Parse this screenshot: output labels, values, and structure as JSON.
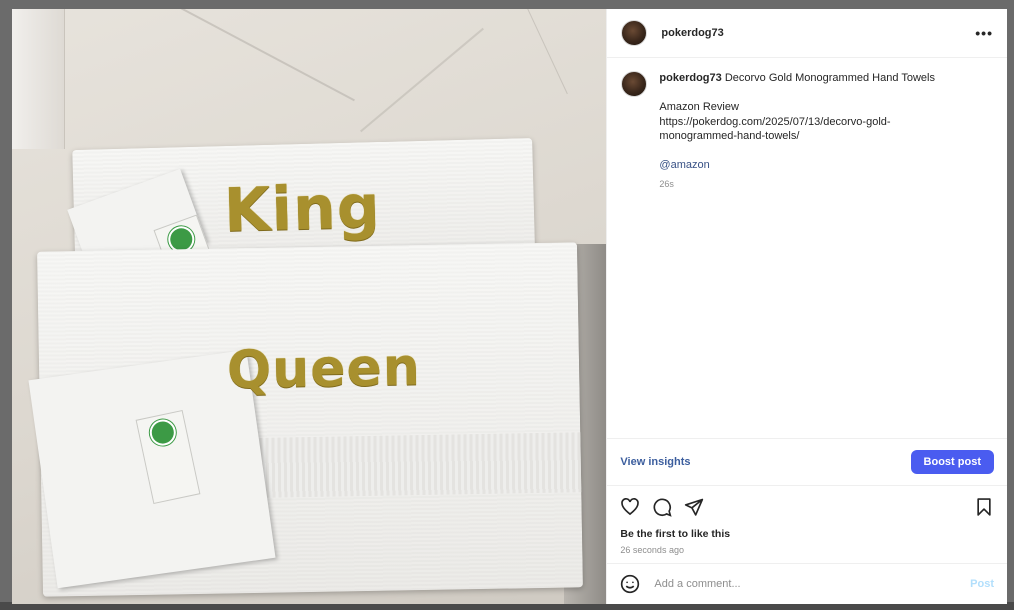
{
  "post": {
    "username": "pokerdog73",
    "photo": {
      "monogram_top": "King",
      "monogram_bottom": "Queen",
      "thread_color": "#a8902e"
    },
    "caption": {
      "username": "pokerdog73",
      "title": "Decorvo Gold Monogrammed Hand Towels",
      "review_label": "Amazon Review",
      "url_line1": "https://pokerdog.com/2025/07/13/decorvo-gold-",
      "url_line2": "monogrammed-hand-towels/",
      "mention": "@amazon",
      "time": "26s"
    },
    "insights_label": "View insights",
    "boost_label": "Boost post",
    "likes_text": "Be the first to like this",
    "time_ago": "26 seconds ago",
    "comment": {
      "placeholder": "Add a comment...",
      "post_label": "Post"
    },
    "icons": {
      "more": "more-options-icon",
      "like": "heart-icon",
      "comment": "comment-icon",
      "share": "share-icon",
      "save": "bookmark-icon",
      "emoji": "emoji-icon"
    },
    "colors": {
      "boost_button": "#4a5cf0",
      "insights_link": "#3c5e9e",
      "mention": "#385185",
      "post_button_disabled": "#b2dffc"
    }
  }
}
